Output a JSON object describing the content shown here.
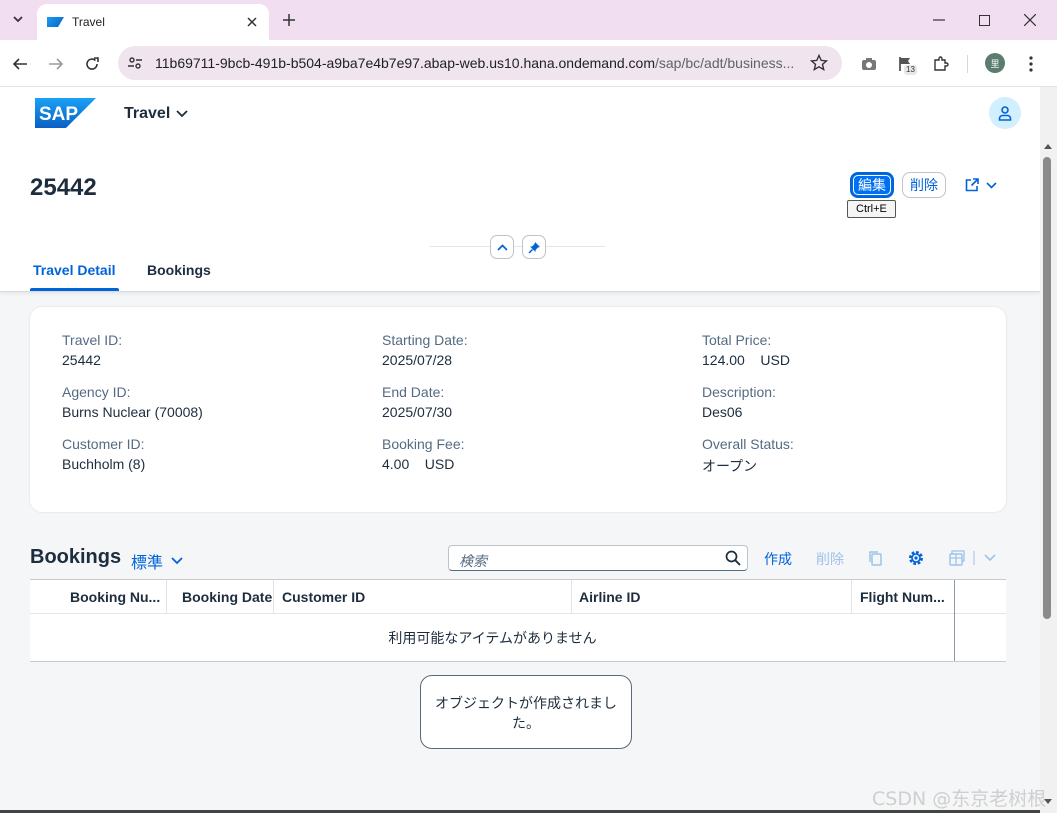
{
  "browser": {
    "tab_title": "Travel",
    "url_main": "11b69711-9bcb-491b-b504-a9ba7e4b7e97.abap-web.us10.hana.ondemand.com",
    "url_path": "/sap/bc/adt/business...",
    "extension_badge": "13",
    "profile_initial": "里"
  },
  "shell": {
    "logo_text": "SAP",
    "app_title": "Travel"
  },
  "header": {
    "object_title": "25442",
    "edit_label": "編集",
    "delete_label": "削除",
    "edit_tooltip": "Ctrl+E",
    "tabs": [
      {
        "label": "Travel Detail",
        "active": true
      },
      {
        "label": "Bookings",
        "active": false
      }
    ]
  },
  "details": {
    "col1": [
      {
        "label": "Travel ID:",
        "value": "25442"
      },
      {
        "label": "Agency ID:",
        "value": "Burns Nuclear (70008)"
      },
      {
        "label": "Customer ID:",
        "value": "Buchholm (8)"
      }
    ],
    "col2": [
      {
        "label": "Starting Date:",
        "value": "2025/07/28"
      },
      {
        "label": "End Date:",
        "value": "2025/07/30"
      },
      {
        "label": "Booking Fee:",
        "value": "4.00    USD"
      }
    ],
    "col3": [
      {
        "label": "Total Price:",
        "value": "124.00    USD"
      },
      {
        "label": "Description:",
        "value": "Des06"
      },
      {
        "label": "Overall Status:",
        "value": "オープン"
      }
    ]
  },
  "bookings": {
    "title": "Bookings",
    "variant": "標準",
    "search_placeholder": "検索",
    "create_label": "作成",
    "delete_label": "削除",
    "columns": [
      "Booking Nu...",
      "Booking Date",
      "Customer ID",
      "Airline ID",
      "Flight Num..."
    ],
    "empty_text": "利用可能なアイテムがありません"
  },
  "toast": {
    "message": "オブジェクトが作成されました。"
  },
  "watermark": "CSDN @东京老树根",
  "colors": {
    "brand": "#0070f2",
    "link": "#0064d9",
    "browser_tab_bar": "#f1def1"
  }
}
